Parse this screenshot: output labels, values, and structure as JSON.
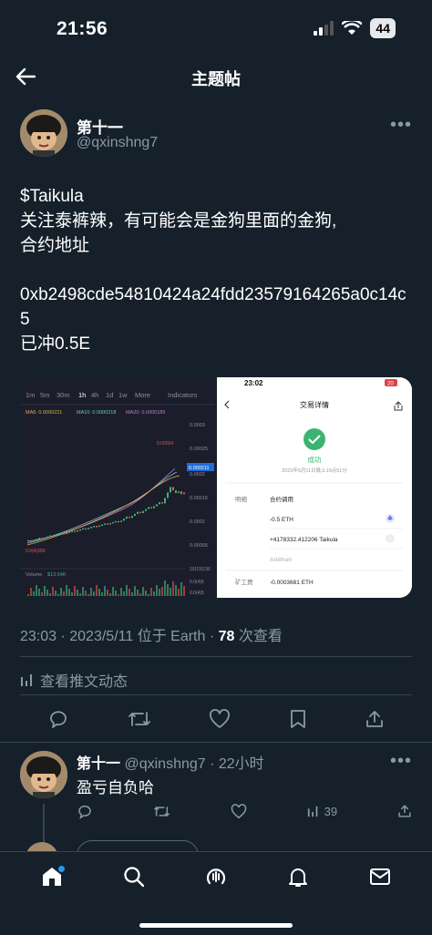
{
  "status": {
    "time": "21:56",
    "battery": "44"
  },
  "header": {
    "title": "主题帖"
  },
  "post": {
    "author_name": "第十一",
    "author_handle": "@qxinshng7",
    "lines": [
      "$Taikula",
      "关注泰裤辣，有可能会是金狗里面的金狗,",
      "合约地址",
      "",
      "0xb2498cde54810424a24fdd23579164265a0c14c5",
      "已冲0.5E"
    ],
    "meta_time": "23:03 · 2023/5/11 位于 Earth · ",
    "views": "78",
    "views_label": " 次查看",
    "analytics_label": "查看推文动态"
  },
  "chart_image": {
    "timeframes": [
      "1m",
      "5m",
      "30m",
      "1h",
      "4h",
      "1d",
      "1w"
    ],
    "more": "More",
    "indicators": "Indicators",
    "ma": [
      "MA5: 0.0000221",
      "MA10: 0.0000218",
      "MA20: 0.0000185"
    ],
    "price_labels": [
      "0.0003",
      "0.00025",
      "0.0002",
      "0.00015",
      "0.0001",
      "0.00005"
    ],
    "current_price": "0.000211",
    "peak_label": "0.00024",
    "low_label": "0.0(4)359",
    "volume_label": "Volume",
    "volume_value": "$13.54K",
    "volume_axis": [
      "10(19)136",
      "0.0(4)5",
      "0.0(4)5"
    ]
  },
  "detail_image": {
    "time": "23:02",
    "battery": "20",
    "title": "交易详情",
    "status": "成功",
    "date": "2023年5月11日晚上10点51分",
    "detail_label": "明细",
    "detail_value": "合约调用",
    "eth_out": "-0.5 ETH",
    "token_in": "+4178332.412206 Taikula",
    "network": "Arbitrum",
    "fee_label": "矿工费",
    "fee_value": "-0.0003681 ETH"
  },
  "reply": {
    "name": "第十一",
    "handle": "@qxinshng7",
    "time": " · 22小时",
    "text": "盈亏自负哈",
    "views": "39"
  }
}
